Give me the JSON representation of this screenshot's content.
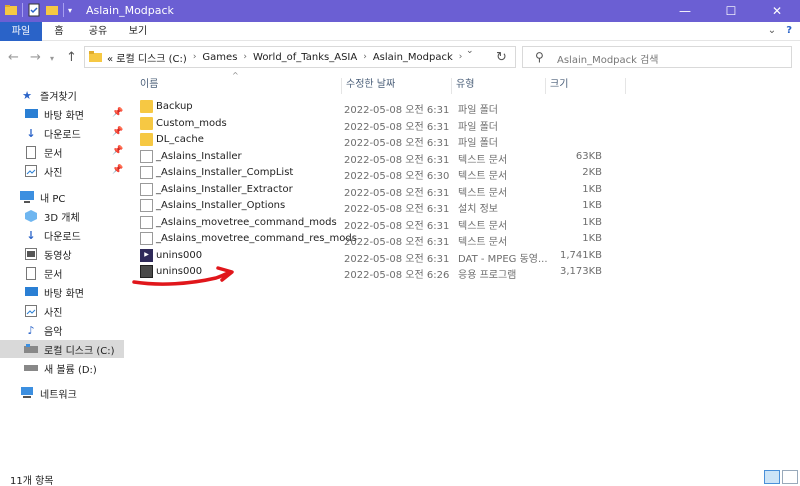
{
  "window": {
    "title": "Aslain_Modpack",
    "controls": {
      "minimize": "—",
      "maximize": "☐",
      "close": "✕"
    }
  },
  "ribbon": {
    "tabs": [
      "파일",
      "홈",
      "공유",
      "보기"
    ]
  },
  "address": {
    "crumbs": [
      "« 로컬 디스크 (C:)",
      "Games",
      "World_of_Tanks_ASIA",
      "Aslain_Modpack"
    ],
    "search_placeholder": "Aslain_Modpack 검색"
  },
  "nav": {
    "items": [
      {
        "label": "즐겨찾기",
        "icon": "star-icon"
      },
      {
        "label": "바탕 화면",
        "icon": "desktop-icon",
        "pinned": true
      },
      {
        "label": "다운로드",
        "icon": "download-icon",
        "pinned": true
      },
      {
        "label": "문서",
        "icon": "document-icon",
        "pinned": true
      },
      {
        "label": "사진",
        "icon": "picture-icon",
        "pinned": true
      },
      {
        "label": "내 PC",
        "icon": "computer-icon"
      },
      {
        "label": "3D 개체",
        "icon": "3d-objects-icon"
      },
      {
        "label": "다운로드",
        "icon": "download-icon"
      },
      {
        "label": "동영상",
        "icon": "video-icon"
      },
      {
        "label": "문서",
        "icon": "document-icon"
      },
      {
        "label": "바탕 화면",
        "icon": "desktop-icon"
      },
      {
        "label": "사진",
        "icon": "picture-icon"
      },
      {
        "label": "음악",
        "icon": "music-icon"
      },
      {
        "label": "로컬 디스크 (C:)",
        "icon": "drive-icon",
        "selected": true
      },
      {
        "label": "새 볼륨 (D:)",
        "icon": "drive-icon"
      },
      {
        "label": "네트워크",
        "icon": "network-icon"
      }
    ]
  },
  "columns": [
    "이름",
    "수정한 날짜",
    "유형",
    "크기"
  ],
  "files": [
    {
      "name": "Backup",
      "date": "2022-05-08 오전 6:31",
      "type": "파일 폴더",
      "size": "",
      "kind": "folder"
    },
    {
      "name": "Custom_mods",
      "date": "2022-05-08 오전 6:31",
      "type": "파일 폴더",
      "size": "",
      "kind": "folder"
    },
    {
      "name": "DL_cache",
      "date": "2022-05-08 오전 6:31",
      "type": "파일 폴더",
      "size": "",
      "kind": "folder"
    },
    {
      "name": "_Aslains_Installer",
      "date": "2022-05-08 오전 6:31",
      "type": "텍스트 문서",
      "size": "63KB",
      "kind": "doc"
    },
    {
      "name": "_Aslains_Installer_CompList",
      "date": "2022-05-08 오전 6:30",
      "type": "텍스트 문서",
      "size": "2KB",
      "kind": "doc"
    },
    {
      "name": "_Aslains_Installer_Extractor",
      "date": "2022-05-08 오전 6:31",
      "type": "텍스트 문서",
      "size": "1KB",
      "kind": "doc"
    },
    {
      "name": "_Aslains_Installer_Options",
      "date": "2022-05-08 오전 6:31",
      "type": "설치 정보",
      "size": "1KB",
      "kind": "doc"
    },
    {
      "name": "_Aslains_movetree_command_mods",
      "date": "2022-05-08 오전 6:31",
      "type": "텍스트 문서",
      "size": "1KB",
      "kind": "doc"
    },
    {
      "name": "_Aslains_movetree_command_res_mods",
      "date": "2022-05-08 오전 6:31",
      "type": "텍스트 문서",
      "size": "1KB",
      "kind": "doc"
    },
    {
      "name": "unins000",
      "date": "2022-05-08 오전 6:31",
      "type": "DAT - MPEG 동영...",
      "size": "1,741KB",
      "kind": "dat"
    },
    {
      "name": "unins000",
      "date": "2022-05-08 오전 6:26",
      "type": "응용 프로그램",
      "size": "3,173KB",
      "kind": "exe"
    }
  ],
  "status": {
    "count": "11개 항목"
  },
  "colors": {
    "titlebar": "#6b5fd3",
    "file_tab": "#2a63c8",
    "annotation": "#e0161b"
  }
}
